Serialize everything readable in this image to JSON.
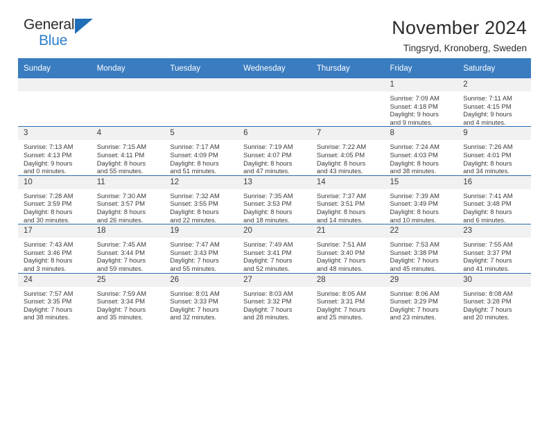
{
  "logo": {
    "word_one": "General",
    "word_two": "Blue",
    "triangle_icon": "triangle-icon"
  },
  "header": {
    "title": "November 2024",
    "subtitle": "Tingsryd, Kronoberg, Sweden"
  },
  "colors": {
    "header_blue": "#3a7cc0",
    "row_divider_blue": "#2b6cad",
    "daynum_gray": "#f1f1f1",
    "logo_blue": "#2a7fc9"
  },
  "calendar": {
    "weekday_headers": [
      "Sunday",
      "Monday",
      "Tuesday",
      "Wednesday",
      "Thursday",
      "Friday",
      "Saturday"
    ],
    "weeks": [
      [
        {
          "day": "",
          "lines": []
        },
        {
          "day": "",
          "lines": []
        },
        {
          "day": "",
          "lines": []
        },
        {
          "day": "",
          "lines": []
        },
        {
          "day": "",
          "lines": []
        },
        {
          "day": "1",
          "lines": [
            "Sunrise: 7:09 AM",
            "Sunset: 4:18 PM",
            "Daylight: 9 hours",
            "and 9 minutes."
          ]
        },
        {
          "day": "2",
          "lines": [
            "Sunrise: 7:11 AM",
            "Sunset: 4:15 PM",
            "Daylight: 9 hours",
            "and 4 minutes."
          ]
        }
      ],
      [
        {
          "day": "3",
          "lines": [
            "Sunrise: 7:13 AM",
            "Sunset: 4:13 PM",
            "Daylight: 9 hours",
            "and 0 minutes."
          ]
        },
        {
          "day": "4",
          "lines": [
            "Sunrise: 7:15 AM",
            "Sunset: 4:11 PM",
            "Daylight: 8 hours",
            "and 55 minutes."
          ]
        },
        {
          "day": "5",
          "lines": [
            "Sunrise: 7:17 AM",
            "Sunset: 4:09 PM",
            "Daylight: 8 hours",
            "and 51 minutes."
          ]
        },
        {
          "day": "6",
          "lines": [
            "Sunrise: 7:19 AM",
            "Sunset: 4:07 PM",
            "Daylight: 8 hours",
            "and 47 minutes."
          ]
        },
        {
          "day": "7",
          "lines": [
            "Sunrise: 7:22 AM",
            "Sunset: 4:05 PM",
            "Daylight: 8 hours",
            "and 43 minutes."
          ]
        },
        {
          "day": "8",
          "lines": [
            "Sunrise: 7:24 AM",
            "Sunset: 4:03 PM",
            "Daylight: 8 hours",
            "and 38 minutes."
          ]
        },
        {
          "day": "9",
          "lines": [
            "Sunrise: 7:26 AM",
            "Sunset: 4:01 PM",
            "Daylight: 8 hours",
            "and 34 minutes."
          ]
        }
      ],
      [
        {
          "day": "10",
          "lines": [
            "Sunrise: 7:28 AM",
            "Sunset: 3:59 PM",
            "Daylight: 8 hours",
            "and 30 minutes."
          ]
        },
        {
          "day": "11",
          "lines": [
            "Sunrise: 7:30 AM",
            "Sunset: 3:57 PM",
            "Daylight: 8 hours",
            "and 26 minutes."
          ]
        },
        {
          "day": "12",
          "lines": [
            "Sunrise: 7:32 AM",
            "Sunset: 3:55 PM",
            "Daylight: 8 hours",
            "and 22 minutes."
          ]
        },
        {
          "day": "13",
          "lines": [
            "Sunrise: 7:35 AM",
            "Sunset: 3:53 PM",
            "Daylight: 8 hours",
            "and 18 minutes."
          ]
        },
        {
          "day": "14",
          "lines": [
            "Sunrise: 7:37 AM",
            "Sunset: 3:51 PM",
            "Daylight: 8 hours",
            "and 14 minutes."
          ]
        },
        {
          "day": "15",
          "lines": [
            "Sunrise: 7:39 AM",
            "Sunset: 3:49 PM",
            "Daylight: 8 hours",
            "and 10 minutes."
          ]
        },
        {
          "day": "16",
          "lines": [
            "Sunrise: 7:41 AM",
            "Sunset: 3:48 PM",
            "Daylight: 8 hours",
            "and 6 minutes."
          ]
        }
      ],
      [
        {
          "day": "17",
          "lines": [
            "Sunrise: 7:43 AM",
            "Sunset: 3:46 PM",
            "Daylight: 8 hours",
            "and 3 minutes."
          ]
        },
        {
          "day": "18",
          "lines": [
            "Sunrise: 7:45 AM",
            "Sunset: 3:44 PM",
            "Daylight: 7 hours",
            "and 59 minutes."
          ]
        },
        {
          "day": "19",
          "lines": [
            "Sunrise: 7:47 AM",
            "Sunset: 3:43 PM",
            "Daylight: 7 hours",
            "and 55 minutes."
          ]
        },
        {
          "day": "20",
          "lines": [
            "Sunrise: 7:49 AM",
            "Sunset: 3:41 PM",
            "Daylight: 7 hours",
            "and 52 minutes."
          ]
        },
        {
          "day": "21",
          "lines": [
            "Sunrise: 7:51 AM",
            "Sunset: 3:40 PM",
            "Daylight: 7 hours",
            "and 48 minutes."
          ]
        },
        {
          "day": "22",
          "lines": [
            "Sunrise: 7:53 AM",
            "Sunset: 3:38 PM",
            "Daylight: 7 hours",
            "and 45 minutes."
          ]
        },
        {
          "day": "23",
          "lines": [
            "Sunrise: 7:55 AM",
            "Sunset: 3:37 PM",
            "Daylight: 7 hours",
            "and 41 minutes."
          ]
        }
      ],
      [
        {
          "day": "24",
          "lines": [
            "Sunrise: 7:57 AM",
            "Sunset: 3:35 PM",
            "Daylight: 7 hours",
            "and 38 minutes."
          ]
        },
        {
          "day": "25",
          "lines": [
            "Sunrise: 7:59 AM",
            "Sunset: 3:34 PM",
            "Daylight: 7 hours",
            "and 35 minutes."
          ]
        },
        {
          "day": "26",
          "lines": [
            "Sunrise: 8:01 AM",
            "Sunset: 3:33 PM",
            "Daylight: 7 hours",
            "and 32 minutes."
          ]
        },
        {
          "day": "27",
          "lines": [
            "Sunrise: 8:03 AM",
            "Sunset: 3:32 PM",
            "Daylight: 7 hours",
            "and 28 minutes."
          ]
        },
        {
          "day": "28",
          "lines": [
            "Sunrise: 8:05 AM",
            "Sunset: 3:31 PM",
            "Daylight: 7 hours",
            "and 25 minutes."
          ]
        },
        {
          "day": "29",
          "lines": [
            "Sunrise: 8:06 AM",
            "Sunset: 3:29 PM",
            "Daylight: 7 hours",
            "and 23 minutes."
          ]
        },
        {
          "day": "30",
          "lines": [
            "Sunrise: 8:08 AM",
            "Sunset: 3:28 PM",
            "Daylight: 7 hours",
            "and 20 minutes."
          ]
        }
      ]
    ]
  }
}
